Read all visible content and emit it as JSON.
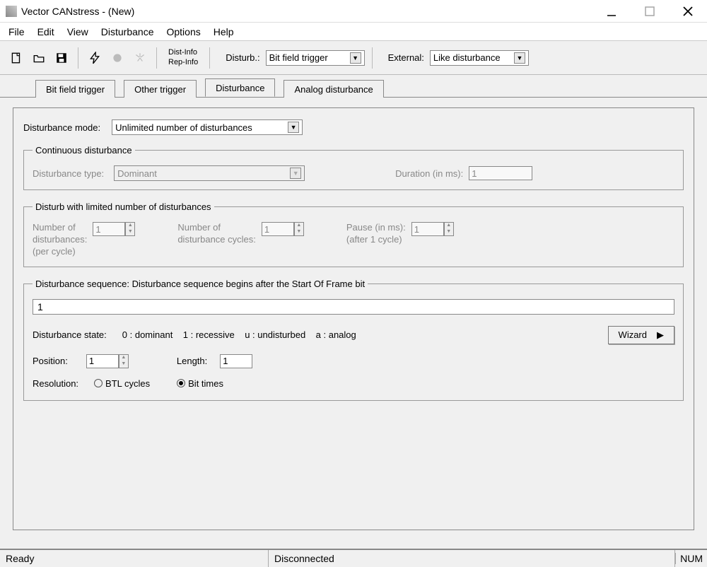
{
  "window": {
    "title": "Vector CANstress - (New)"
  },
  "menu": [
    "File",
    "Edit",
    "View",
    "Disturbance",
    "Options",
    "Help"
  ],
  "toolbar": {
    "dist_info": "Dist-Info",
    "rep_info": "Rep-Info",
    "disturb_lbl": "Disturb.:",
    "disturb_val": "Bit field trigger",
    "external_lbl": "External:",
    "external_val": "Like disturbance"
  },
  "tabs": {
    "bit_field": "Bit field trigger",
    "other": "Other trigger",
    "disturbance": "Disturbance",
    "analog": "Analog disturbance"
  },
  "main": {
    "mode_lbl": "Disturbance mode:",
    "mode_val": "Unlimited number of disturbances",
    "continuous": {
      "legend": "Continuous disturbance",
      "type_lbl": "Disturbance type:",
      "type_val": "Dominant",
      "duration_lbl": "Duration (in ms):",
      "duration_val": "1"
    },
    "limited": {
      "legend": "Disturb with limited number of disturbances",
      "num_lbl1": "Number of",
      "num_lbl2": "disturbances:",
      "num_lbl3": "(per cycle)",
      "num_val": "1",
      "cycles_lbl1": "Number of",
      "cycles_lbl2": "disturbance cycles:",
      "cycles_val": "1",
      "pause_lbl1": "Pause (in ms):",
      "pause_lbl2": "(after 1 cycle)",
      "pause_val": "1"
    },
    "sequence": {
      "legend": "Disturbance sequence:    Disturbance sequence begins after the Start Of Frame bit",
      "seq_val": "1",
      "state_lbl": "Disturbance state:",
      "state_key": "0 : dominant    1 : recessive    u : undisturbed    a : analog",
      "wizard": "Wizard",
      "position_lbl": "Position:",
      "position_val": "1",
      "length_lbl": "Length:",
      "length_val": "1",
      "resolution_lbl": "Resolution:",
      "opt_btl": "BTL cycles",
      "opt_bit": "Bit times"
    }
  },
  "status": {
    "ready": "Ready",
    "conn": "Disconnected",
    "num": "NUM"
  }
}
